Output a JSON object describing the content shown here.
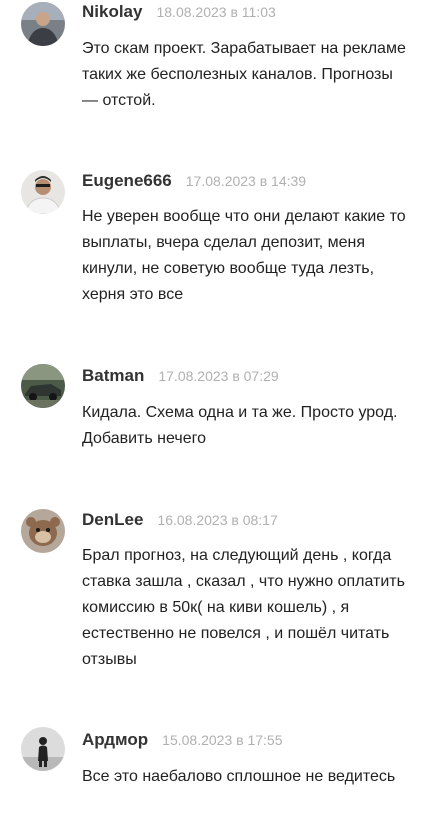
{
  "comments": [
    {
      "author": "Nikolay",
      "date": "18.08.2023 в 11:03",
      "avatar_icon": "user-photo-icon",
      "text": "Это скам проект. Зарабатывает на рекламе таких же бесполезных каналов. Прогнозы — отстой."
    },
    {
      "author": "Eugene666",
      "date": "17.08.2023 в 14:39",
      "avatar_icon": "user-photo-icon",
      "text": "Не уверен вообще что они делают какие то выплаты, вчера сделал депозит, меня кинули, не советую вообще туда лезть, херня это все"
    },
    {
      "author": "Batman",
      "date": "17.08.2023 в 07:29",
      "avatar_icon": "car-photo-icon",
      "text": "Кидала. Схема одна и та же. Просто урод. Добавить нечего"
    },
    {
      "author": "DenLee",
      "date": "16.08.2023 в 08:17",
      "avatar_icon": "animal-photo-icon",
      "text": "Брал прогноз, на следующий день , когда ставка зашла , сказал , что нужно оплатить комиссию в 50к( на киви кошель) , я естественно не повелся , и пошёл читать отзывы"
    },
    {
      "author": "Ардмор",
      "date": "15.08.2023 в 17:55",
      "avatar_icon": "silhouette-photo-icon",
      "text": "Все это наебалово сплошное не ведитесь"
    }
  ]
}
